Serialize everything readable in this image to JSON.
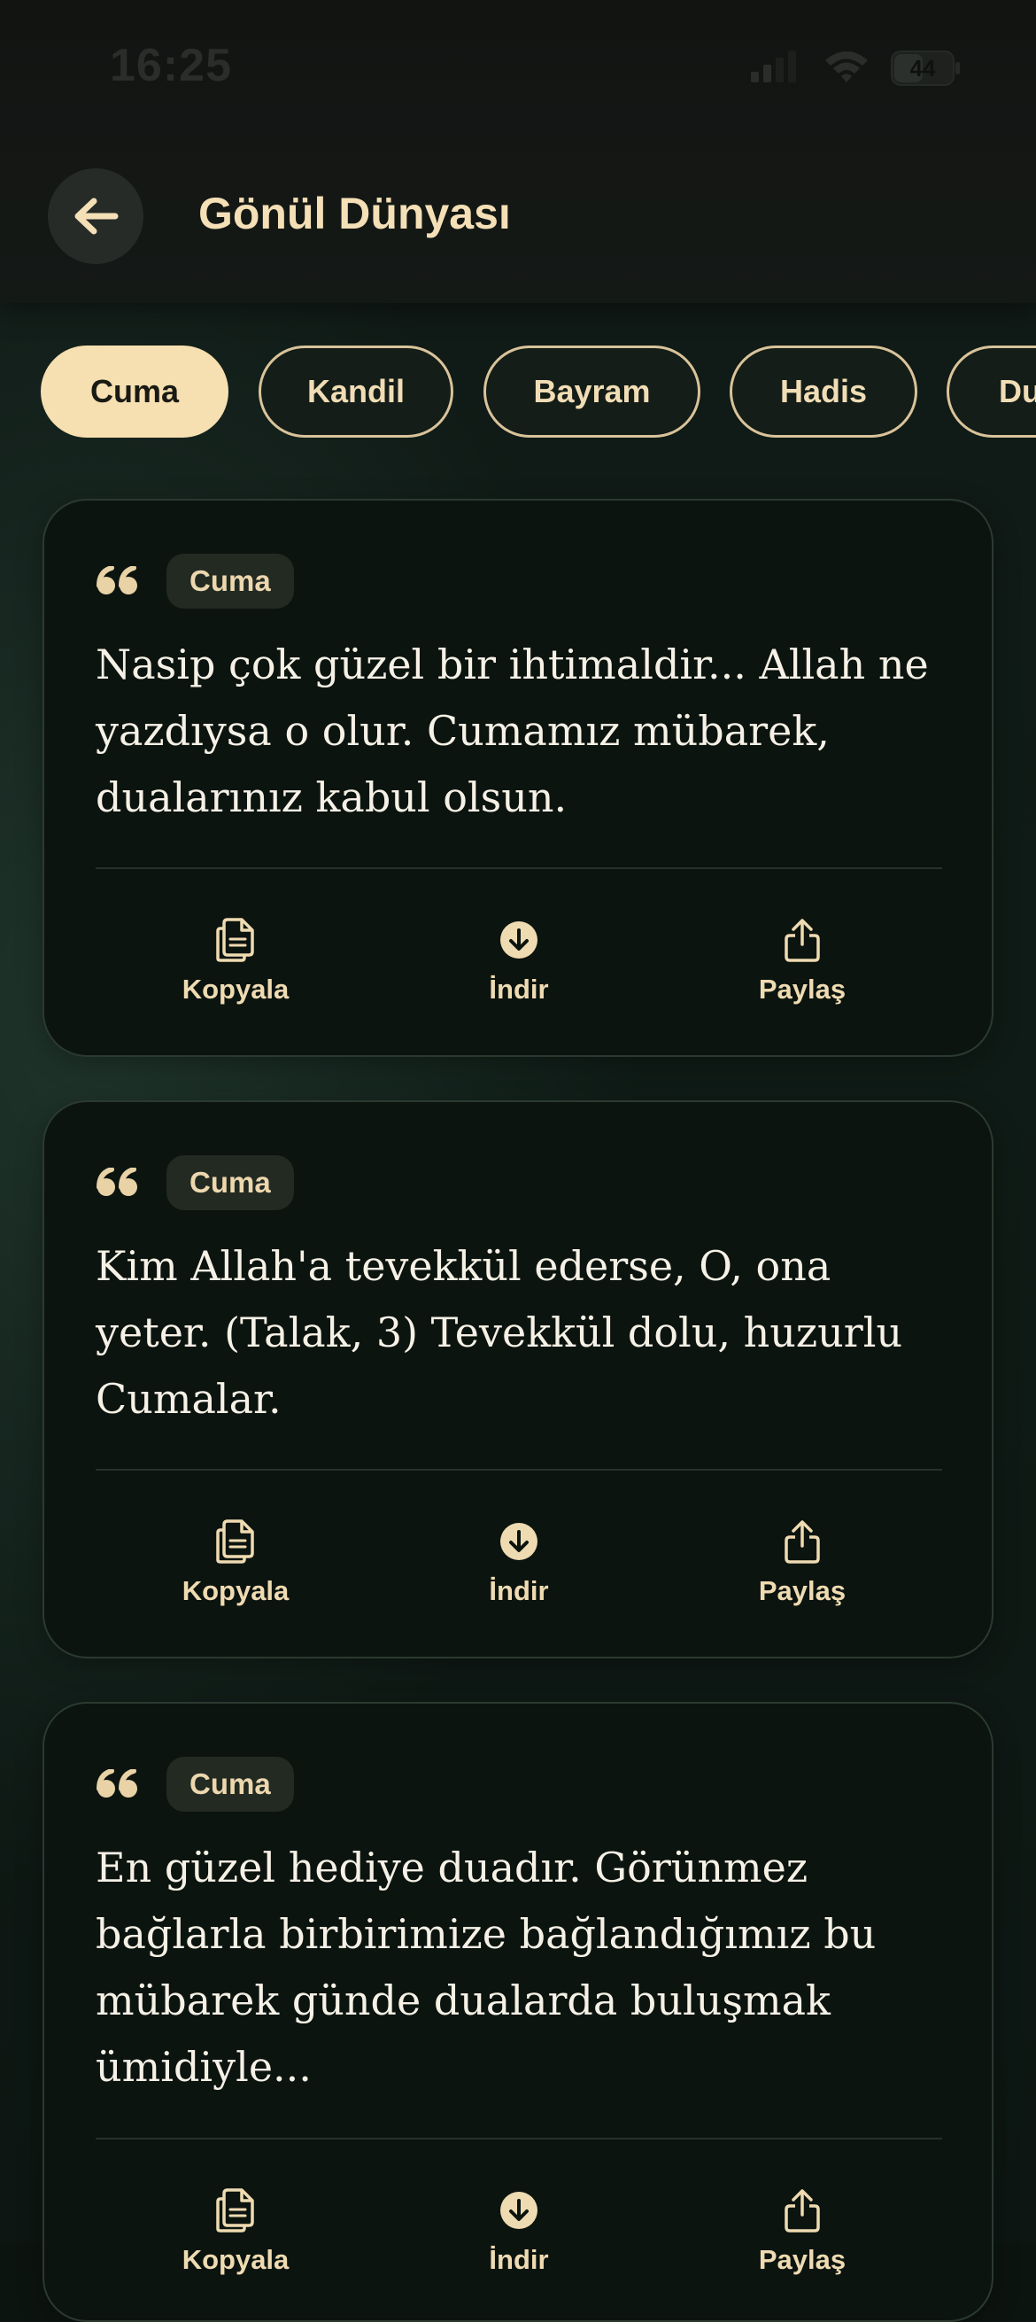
{
  "status_bar": {
    "time": "16:25",
    "battery": "44"
  },
  "header": {
    "title": "Gönül Dünyası",
    "back_icon": "arrow-left-icon"
  },
  "categories": [
    {
      "label": "Cuma",
      "active": true
    },
    {
      "label": "Kandil",
      "active": false
    },
    {
      "label": "Bayram",
      "active": false
    },
    {
      "label": "Hadis",
      "active": false
    },
    {
      "label": "Du",
      "active": false
    }
  ],
  "actions": {
    "copy": "Kopyala",
    "download": "İndir",
    "share": "Paylaş"
  },
  "cards": [
    {
      "tag": "Cuma",
      "text": "Nasip çok güzel bir ihtimaldir... Allah ne yazdıysa o olur. Cumamız mübarek, dualarınız kabul olsun."
    },
    {
      "tag": "Cuma",
      "text": "Kim Allah'a tevekkül ederse, O, ona yeter. (Talak, 3) Tevekkül dolu, huzurlu Cumalar."
    },
    {
      "tag": "Cuma",
      "text": "En güzel hediye duadır. Görünmez bağlarla birbirimize bağlandığımız bu mübarek günde dualarda buluşmak ümidiyle..."
    }
  ],
  "colors": {
    "accent": "#f6dfb0",
    "background": "#0f1b16",
    "card": "#0c140f",
    "text": "#f6f1e6"
  }
}
